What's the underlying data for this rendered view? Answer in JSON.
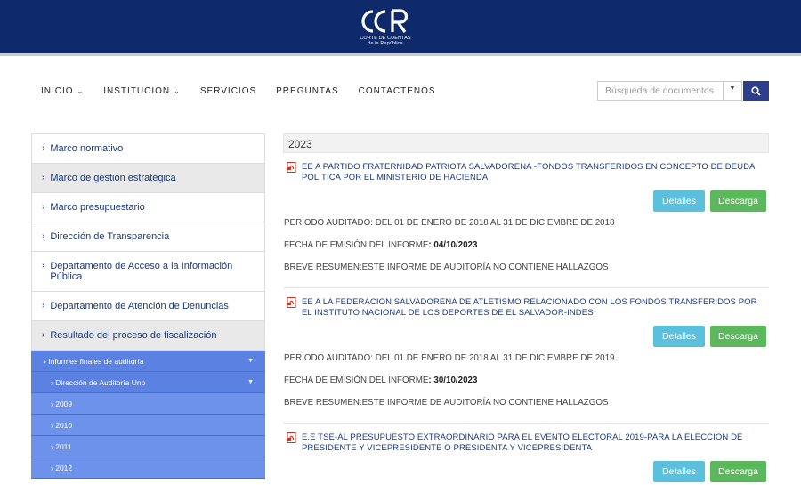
{
  "header": {
    "logo_text": "CCR",
    "logo_subtitle_1": "CORTE DE CUENTAS",
    "logo_subtitle_2": "de la República"
  },
  "nav": [
    {
      "label": "INICIO",
      "has_dropdown": true
    },
    {
      "label": "INSTITUCION",
      "has_dropdown": true
    },
    {
      "label": "SERVICIOS",
      "has_dropdown": false
    },
    {
      "label": "PREGUNTAS",
      "has_dropdown": false
    },
    {
      "label": "CONTACTENOS",
      "has_dropdown": false
    }
  ],
  "search": {
    "placeholder": "Búsqueda de documentos"
  },
  "sidebar": {
    "items": [
      {
        "label": "Marco normativo"
      },
      {
        "label": "Marco de gestión estratégica"
      },
      {
        "label": "Marco presupuestario"
      },
      {
        "label": "Dirección de Transparencia"
      },
      {
        "label": "Departamento de Acceso a la Información Pública"
      },
      {
        "label": "Departamento de Atención de Denuncias"
      },
      {
        "label": "Resultado del proceso de fiscalización"
      }
    ],
    "subitems": [
      {
        "label": "Informes finales de auditoría"
      },
      {
        "label": "Dirección de Auditoría Uno"
      },
      {
        "label": "2009"
      },
      {
        "label": "2010"
      },
      {
        "label": "2011"
      },
      {
        "label": "2012"
      }
    ]
  },
  "main": {
    "year": "2023",
    "detalles_label": "Detalles",
    "descarga_label": "Descarga",
    "entries": [
      {
        "title": "EE A PARTIDO FRATERNIDAD PATRIOTA SALVADORENA -FONDOS TRANSFERIDOS EN CONCEPTO DE DEUDA POLITICA POR EL MINISTERIO DE HACIENDA",
        "periodo": "PERIODO AUDITADO: DEL 01 DE ENERO DE 2018 AL 31 DE DICIEMBRE DE 2018",
        "fecha_label": "FECHA DE EMISIÓN DEL INFORME",
        "fecha_value": ": 04/10/2023",
        "resumen": "BREVE RESUMEN:ESTE INFORME DE AUDITORÍA NO CONTIENE HALLAZGOS"
      },
      {
        "title": "EE A LA FEDERACION SALVADORENA DE ATLETISMO RELACIONADO CON LOS FONDOS TRANSFERIDOS POR EL INSTITUTO NACIONAL DE LOS DEPORTES DE EL SALVADOR-INDES",
        "periodo": "PERIODO AUDITADO: DEL 01 DE ENERO DE 2018 AL 31 DE DICIEMBRE DE 2019",
        "fecha_label": "FECHA DE EMISIÓN DEL INFORME",
        "fecha_value": ": 30/10/2023",
        "resumen": "BREVE RESUMEN:ESTE INFORME DE AUDITORÍA NO CONTIENE HALLAZGOS"
      },
      {
        "title": "E.E TSE-AL PRESUPUESTO EXTRAORDINARIO PARA EL EVENTO ELECTORAL 2019-PARA LA ELECCION DE PRESIDENTE Y VICEPRESIDENTE O PRESIDENTA Y VICEPRESIDENTA"
      }
    ]
  }
}
